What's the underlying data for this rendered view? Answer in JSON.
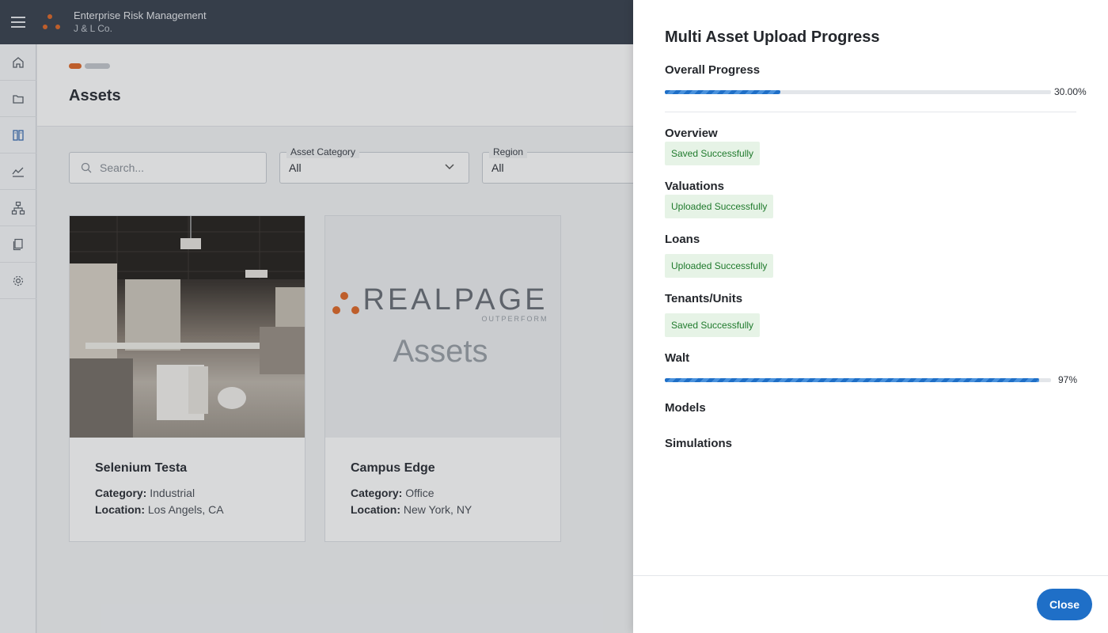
{
  "header": {
    "app_name": "Enterprise Risk Management",
    "org_name": "J & L Co."
  },
  "page": {
    "title": "Assets",
    "search": {
      "placeholder": "Search..."
    },
    "filters": [
      {
        "label": "Asset Category",
        "value": "All"
      },
      {
        "label": "Region",
        "value": "All"
      }
    ],
    "assets": [
      {
        "name": "Selenium Testa",
        "category_label": "Category:",
        "category": "Industrial",
        "location_label": "Location:",
        "location": "Los Angels, CA"
      },
      {
        "name": "Campus Edge",
        "category_label": "Category:",
        "category": "Office",
        "location_label": "Location:",
        "location": "New York, NY",
        "placeholder_brand": "REALPAGE",
        "placeholder_tagline": "OUTPERFORM",
        "placeholder_text": "Assets"
      }
    ]
  },
  "drawer": {
    "title": "Multi Asset Upload Progress",
    "overall": {
      "label": "Overall Progress",
      "percent_text": "30.00%",
      "value": 0.3
    },
    "sections": [
      {
        "label": "Overview",
        "status": "Saved Successfully"
      },
      {
        "label": "Valuations",
        "status": "Uploaded Successfully"
      },
      {
        "label": "Loans",
        "status": "Uploaded Successfully"
      },
      {
        "label": "Tenants/Units",
        "status": "Saved Successfully"
      },
      {
        "label": "Walt",
        "percent_text": "97%",
        "value": 0.97
      },
      {
        "label": "Models"
      },
      {
        "label": "Simulations"
      }
    ],
    "close_label": "Close"
  },
  "colors": {
    "topbar": "#3a4350",
    "accent_orange": "#e06a2a",
    "primary_blue": "#1f6fc7",
    "success_bg": "#e6f3e6",
    "success_text": "#1f7a2c"
  },
  "icons": [
    "menu-icon",
    "home-icon",
    "folder-icon",
    "assets-icon",
    "chart-icon",
    "hierarchy-icon",
    "documents-icon",
    "settings-icon",
    "search-icon",
    "chevron-down-icon"
  ]
}
